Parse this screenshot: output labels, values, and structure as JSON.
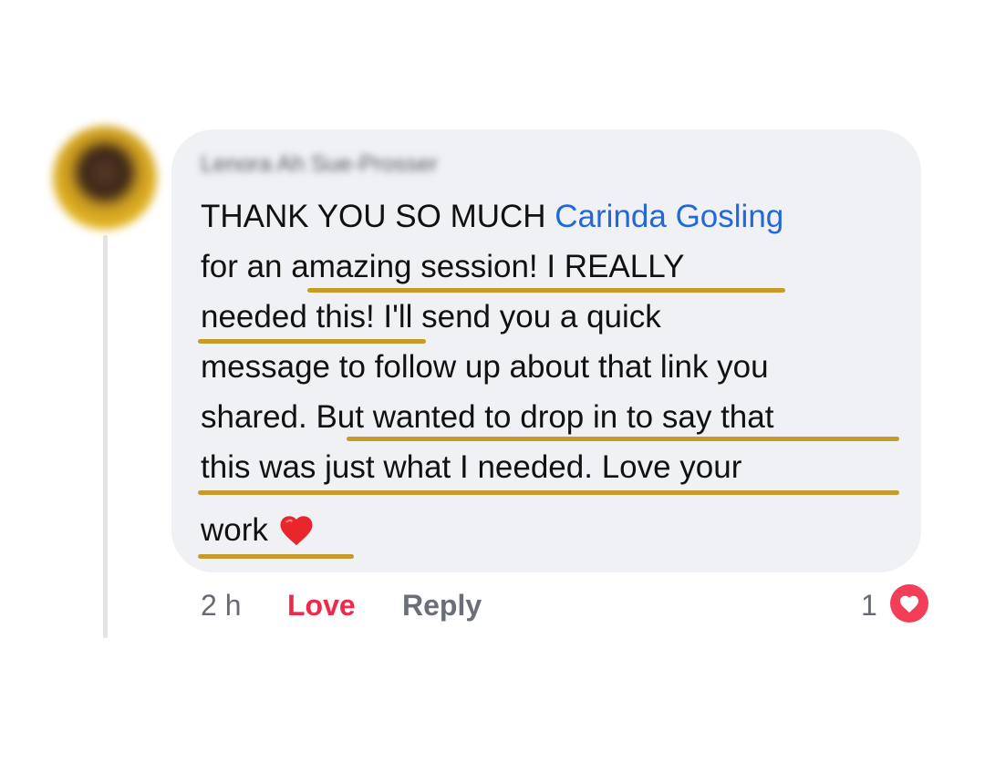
{
  "comment": {
    "author": "Lenora Ah Sue-Prosser",
    "lines": [
      {
        "prefix": "THANK YOU SO MUCH ",
        "mention": "Carinda Gosling"
      },
      {
        "text": "for an amazing session!  I REALLY"
      },
      {
        "text": "needed this!  I'll send you a quick"
      },
      {
        "text": "message to follow up about that link you"
      },
      {
        "text": "shared. But wanted to drop in to say that"
      },
      {
        "text": "this was just what I needed.  Love your"
      },
      {
        "text": "work",
        "emoji": "heart-emoji"
      }
    ]
  },
  "footer": {
    "time": "2 h",
    "love_label": "Love",
    "reply_label": "Reply",
    "reaction_count": "1",
    "reaction_icon": "heart-icon"
  },
  "colors": {
    "bubble": "#f0f1f4",
    "mention": "#2368d8",
    "love": "#f02849",
    "underline": "#c79a2a"
  }
}
